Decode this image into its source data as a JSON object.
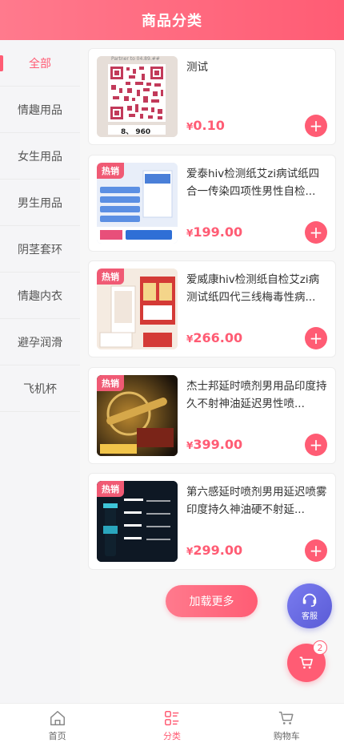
{
  "header": {
    "title": "商品分类"
  },
  "sidebar": {
    "items": [
      {
        "label": "全部",
        "active": true
      },
      {
        "label": "情趣用品"
      },
      {
        "label": "女生用品"
      },
      {
        "label": "男生用品"
      },
      {
        "label": "阴茎套环"
      },
      {
        "label": "情趣内衣"
      },
      {
        "label": "避孕润滑"
      },
      {
        "label": "飞机杯"
      }
    ]
  },
  "products": [
    {
      "title": "测试",
      "currency": "¥",
      "price": "0.10",
      "hot": false,
      "thumb_text": "8、 960",
      "thumb_top_text": "Partner to 04.89.## "
    },
    {
      "title": "爱泰hiv检测纸艾zi病试纸四合一传染四项性男性自检...",
      "currency": "¥",
      "price": "199.00",
      "hot": true,
      "badge": "热销"
    },
    {
      "title": "爱威康hiv检测纸自检艾zi病测试纸四代三线梅毒性病...",
      "currency": "¥",
      "price": "266.00",
      "hot": true,
      "badge": "热销"
    },
    {
      "title": "杰士邦延时喷剂男用品印度持久不射神油延迟男性喷...",
      "currency": "¥",
      "price": "399.00",
      "hot": true,
      "badge": "热销"
    },
    {
      "title": "第六感延时喷剂男用延迟喷雾印度持久神油硬不射延...",
      "currency": "¥",
      "price": "299.00",
      "hot": true,
      "badge": "热销"
    }
  ],
  "load_more": {
    "label": "加载更多"
  },
  "service": {
    "label": "客服"
  },
  "cart_float": {
    "count": "2"
  },
  "tabbar": {
    "items": [
      {
        "label": "首页",
        "icon": "home-icon"
      },
      {
        "label": "分类",
        "icon": "category-icon",
        "active": true
      },
      {
        "label": "购物车",
        "icon": "cart-icon"
      }
    ]
  },
  "colors": {
    "accent": "#ff5c74",
    "service": "#6a6be0"
  }
}
